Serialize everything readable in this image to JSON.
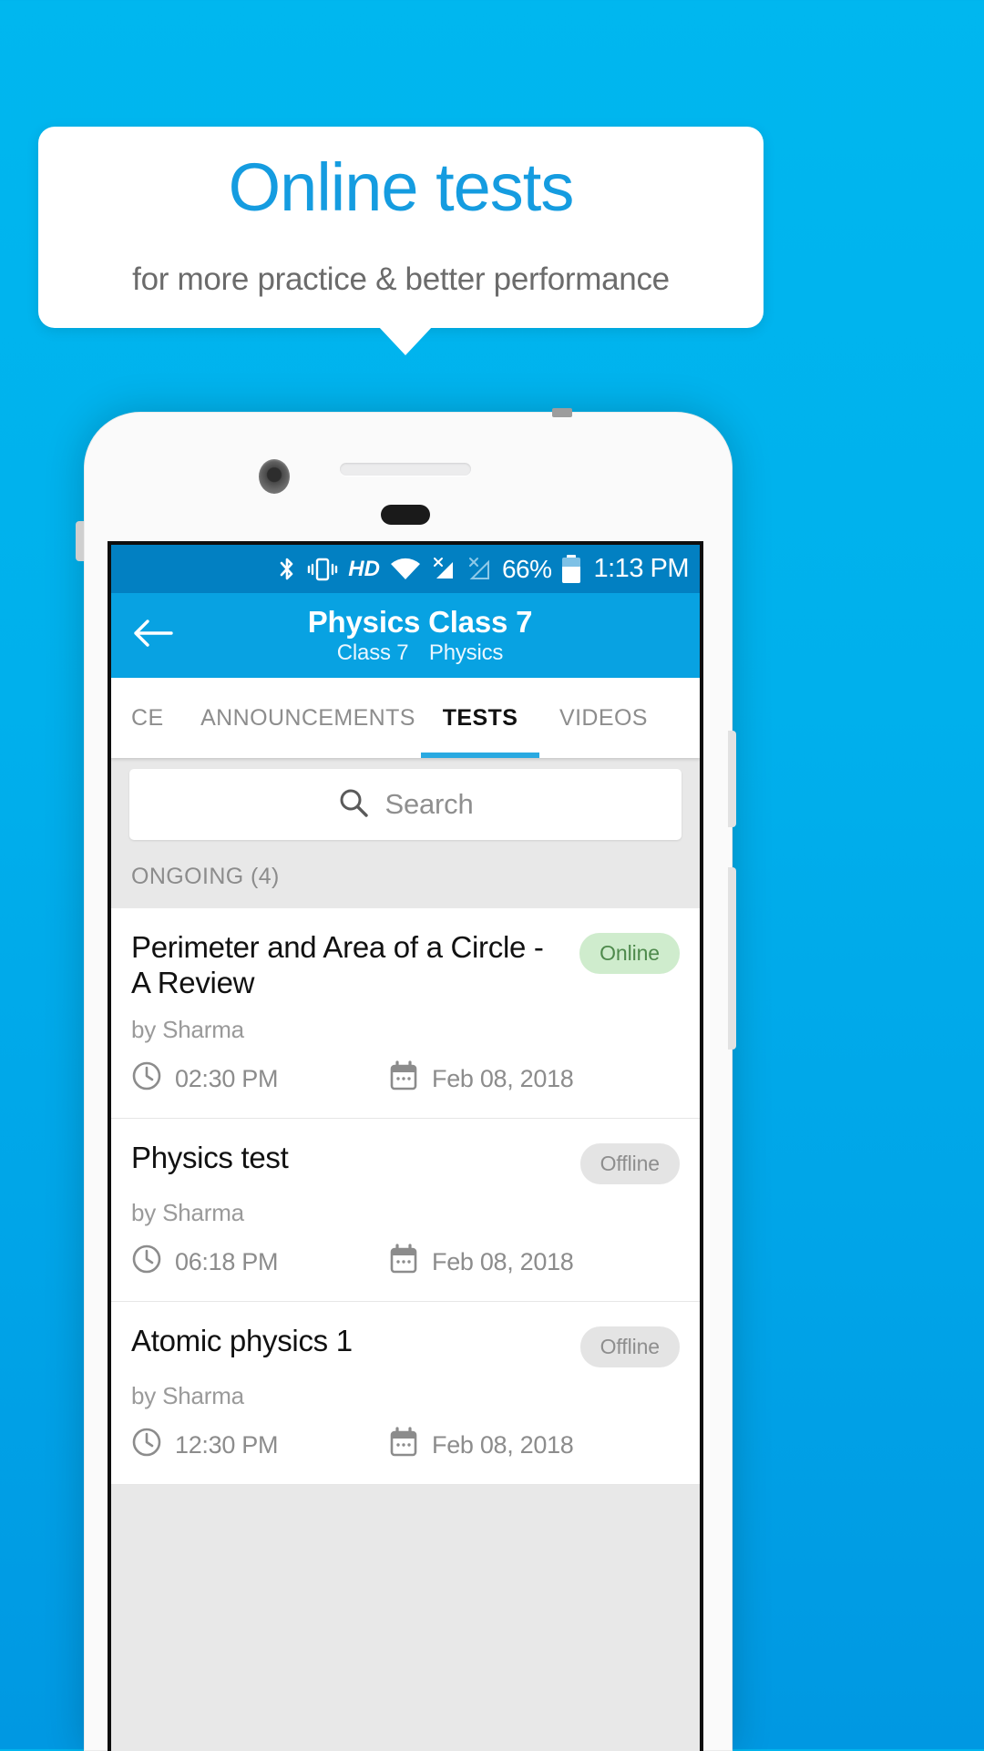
{
  "promo": {
    "headline": "Online tests",
    "subhead": "for more practice & better performance",
    "headline_color": "#159ce0",
    "background_color": "#00b0ec"
  },
  "status_bar": {
    "icons": [
      "bluetooth-icon",
      "vibrate-icon",
      "hd-icon",
      "wifi-icon",
      "signal-1-icon",
      "signal-2-icon"
    ],
    "hd_label": "HD",
    "battery_percent": "66%",
    "time": "1:13 PM"
  },
  "app_bar": {
    "back_icon": "back-arrow-icon",
    "title": "Physics Class 7",
    "subtitle_class": "Class 7",
    "subtitle_subject": "Physics",
    "background_color": "#08a2e2"
  },
  "tabs": {
    "items": [
      {
        "label": "CE",
        "active": false
      },
      {
        "label": "ANNOUNCEMENTS",
        "active": false
      },
      {
        "label": "TESTS",
        "active": true
      },
      {
        "label": "VIDEOS",
        "active": false
      }
    ],
    "indicator_color": "#29a9e1"
  },
  "search": {
    "icon": "search-icon",
    "placeholder": "Search",
    "value": ""
  },
  "section": {
    "header": "ONGOING (4)"
  },
  "tests": [
    {
      "title": "Perimeter and Area of a Circle - A Review",
      "author": "by Sharma",
      "status": "Online",
      "status_type": "online",
      "time": "02:30 PM",
      "date": "Feb 08, 2018"
    },
    {
      "title": "Physics test",
      "author": "by Sharma",
      "status": "Offline",
      "status_type": "offline",
      "time": "06:18 PM",
      "date": "Feb 08, 2018"
    },
    {
      "title": "Atomic physics 1",
      "author": "by Sharma",
      "status": "Offline",
      "status_type": "offline",
      "time": "12:30 PM",
      "date": "Feb 08, 2018"
    }
  ],
  "colors": {
    "badge_online_bg": "#cfeccd",
    "badge_online_text": "#4e8a4c",
    "badge_offline_bg": "#e4e4e4",
    "badge_offline_text": "#8e8e8e",
    "status_bar_bg": "#0280c2"
  }
}
